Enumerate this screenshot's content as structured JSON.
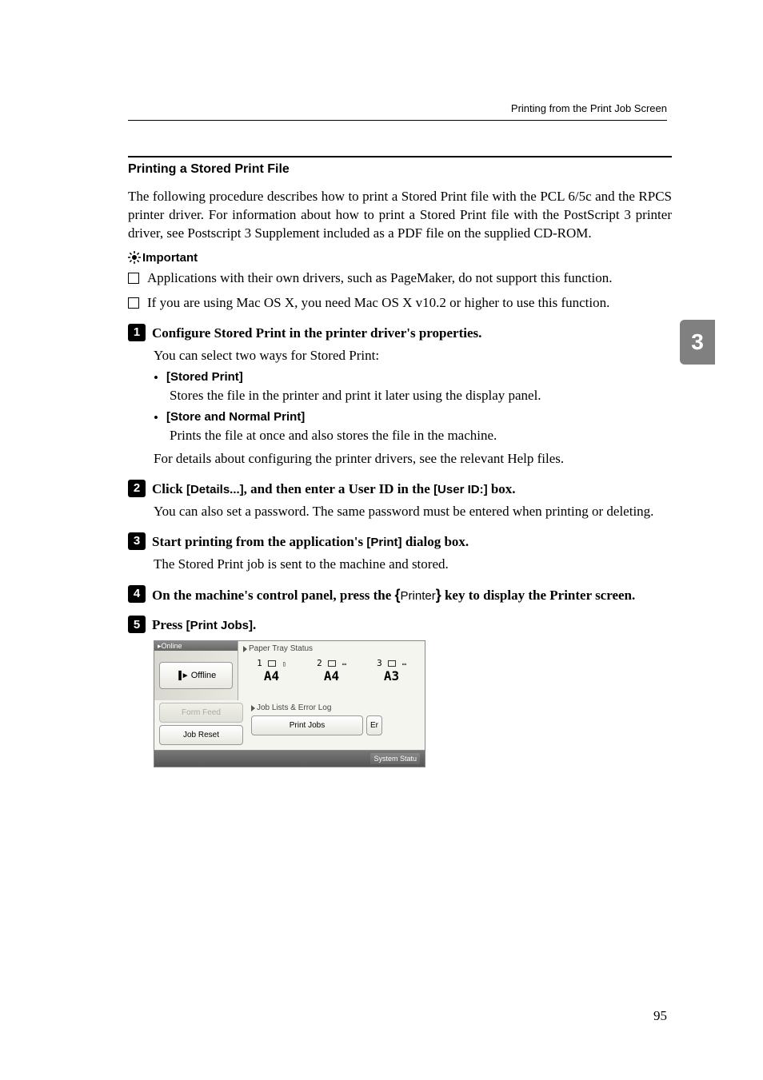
{
  "header": {
    "right_text": "Printing from the Print Job Screen"
  },
  "section_title": "Printing a Stored Print File",
  "intro_text": "The following procedure describes how to print a Stored Print file with the PCL 6/5c and the RPCS printer driver. For information about how to print a Stored Print file with the PostScript 3 printer driver, see Postscript 3 Supplement included as a PDF file on the supplied CD-ROM.",
  "important_label": "Important",
  "important_items": [
    "Applications with their own drivers, such as PageMaker, do not support this function.",
    "If you are using Mac OS X, you need Mac OS X v10.2 or higher to use this function."
  ],
  "steps": [
    {
      "num": "1",
      "title": "Configure Stored Print in the printer driver's properties.",
      "body": "You can select two ways for Stored Print:",
      "sub_items": [
        {
          "label": "[Stored Print]",
          "desc": "Stores the file in the printer and print it later using the display panel."
        },
        {
          "label": "[Store and Normal Print]",
          "desc": "Prints the file at once and also stores the file in the machine."
        }
      ],
      "footer": "For details about configuring the printer drivers, see the relevant Help files."
    },
    {
      "num": "2",
      "title_pre": "Click ",
      "title_bold1": "[Details...]",
      "title_mid": ", and then enter a User ID in the ",
      "title_bold2": "[User ID:]",
      "title_post": " box.",
      "body": "You can also set a password. The same password must be entered when printing or deleting."
    },
    {
      "num": "3",
      "title_pre": "Start printing from the application's ",
      "title_bold1": "[Print]",
      "title_post": " dialog box.",
      "body": "The Stored Print job is sent to the machine and stored."
    },
    {
      "num": "4",
      "title_pre": "On the machine's control panel, press the ",
      "title_key": "Printer",
      "title_post": " key to display the Printer screen."
    },
    {
      "num": "5",
      "title_pre": "Press ",
      "title_bold1": "[Print Jobs]",
      "title_post": "."
    }
  ],
  "screenshot": {
    "tray_status_label": "Paper Tray Status",
    "offline_label": "Offline",
    "trays": [
      {
        "num": "1",
        "size": "A4"
      },
      {
        "num": "2",
        "size": "A4"
      },
      {
        "num": "3",
        "size": "A3"
      }
    ],
    "form_feed": "Form Feed",
    "job_reset": "Job Reset",
    "job_lists_label": "Job Lists & Error Log",
    "print_jobs": "Print Jobs",
    "er": "Er",
    "system_status": "System Statu"
  },
  "side_tab": "3",
  "page_number": "95"
}
